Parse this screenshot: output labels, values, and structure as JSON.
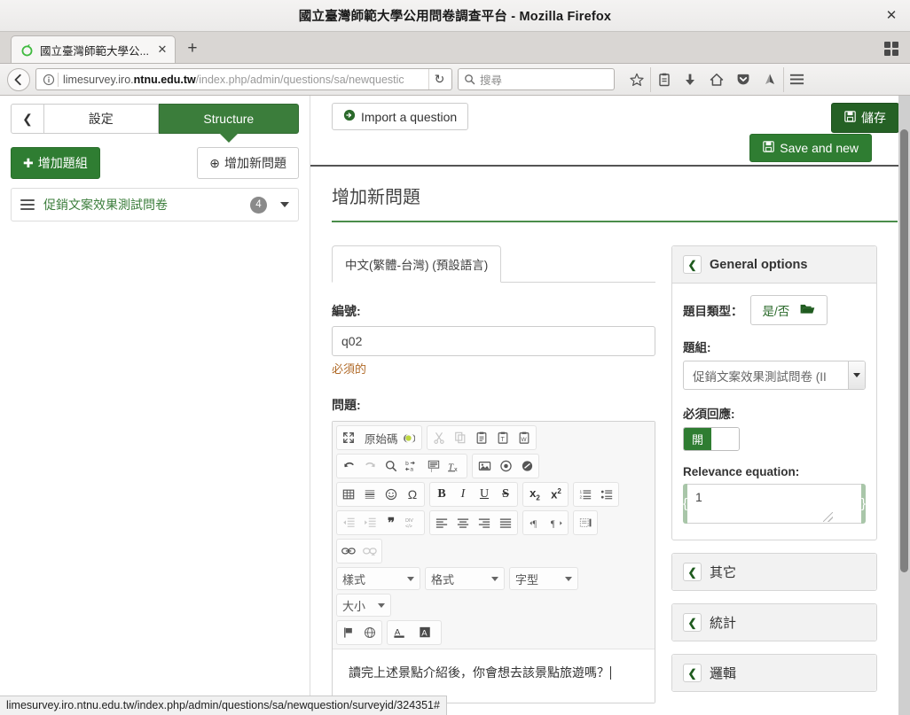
{
  "browser": {
    "window_title": "國立臺灣師範大學公用問卷調查平台 - Mozilla Firefox",
    "close_label": "✕",
    "tab": {
      "title": "國立臺灣師範大學公...",
      "close_label": "✕",
      "new_tab_label": "+"
    },
    "url": {
      "prefix": "limesurvey.iro.",
      "domain": "ntnu.edu.tw",
      "path": "/index.php/admin/questions/sa/newquestic",
      "full": "limesurvey.iro.ntnu.edu.tw/index.php/admin/questions/sa/newquestic"
    },
    "search_placeholder": "搜尋",
    "statusbar_url": "limesurvey.iro.ntnu.edu.tw/index.php/admin/questions/sa/newquestion/surveyid/324351#"
  },
  "sidebar": {
    "collapse_label": "❮",
    "tabs": [
      {
        "label": "設定",
        "active": false
      },
      {
        "label": "Structure",
        "active": true
      }
    ],
    "add_group_label": "增加題組",
    "add_question_label": "增加新問題",
    "groups": [
      {
        "name": "促銷文案效果測試問卷",
        "count": "4"
      }
    ]
  },
  "toolbar": {
    "import_label": "Import a question",
    "save_label": "儲存",
    "save_and_new_label": "Save and new"
  },
  "main": {
    "page_title": "增加新問題",
    "language_tab": "中文(繁體-台灣) (預設語言)",
    "code_label": "編號:",
    "code_value": "q02",
    "code_help": "必須的",
    "question_label": "問題:",
    "question_text": "讀完上述景點介紹後，你會想去該景點旅遊嗎？"
  },
  "editor": {
    "row1_group1": [
      {
        "icon": "maximize-icon",
        "glyph": "⤢"
      },
      {
        "icon": "source-icon",
        "glyph": "原始碼",
        "text": true
      },
      {
        "icon": "limesurvey-leaf-icon",
        "glyph": "❨❩"
      }
    ],
    "row1_group2": [
      {
        "icon": "cut-icon",
        "glyph": "✂",
        "disabled": true
      },
      {
        "icon": "copy-icon",
        "glyph": "❐",
        "disabled": true
      },
      {
        "icon": "paste-icon",
        "glyph": "📋"
      },
      {
        "icon": "paste-text-icon",
        "glyph": "T"
      },
      {
        "icon": "paste-word-icon",
        "glyph": "W"
      }
    ],
    "row2_group1": [
      {
        "icon": "undo-icon",
        "glyph": "↰"
      },
      {
        "icon": "redo-icon",
        "glyph": "↱",
        "disabled": true
      },
      {
        "icon": "find-icon",
        "glyph": "🔍"
      },
      {
        "icon": "replace-icon",
        "glyph": "ab"
      },
      {
        "icon": "select-all-icon",
        "glyph": "☰"
      },
      {
        "icon": "remove-format-icon",
        "glyph": "Tx"
      }
    ],
    "row2_group2": [
      {
        "icon": "image-icon",
        "glyph": "🖼"
      },
      {
        "icon": "media-icon",
        "glyph": "⏺"
      },
      {
        "icon": "flash-icon",
        "glyph": "◍"
      }
    ],
    "row3_group1": [
      {
        "icon": "table-icon",
        "glyph": "▦"
      },
      {
        "icon": "horizontal-rule-icon",
        "glyph": "▤"
      },
      {
        "icon": "smiley-icon",
        "glyph": "☺"
      },
      {
        "icon": "special-char-icon",
        "glyph": "Ω"
      }
    ],
    "row3_group2": [
      {
        "icon": "bold-icon",
        "glyph": "B"
      },
      {
        "icon": "italic-icon",
        "glyph": "I"
      },
      {
        "icon": "underline-icon",
        "glyph": "U"
      },
      {
        "icon": "strikethrough-icon",
        "glyph": "S"
      }
    ],
    "row3_group3": [
      {
        "icon": "subscript-icon",
        "glyph": "x₂"
      },
      {
        "icon": "superscript-icon",
        "glyph": "x²"
      }
    ],
    "row3_group4": [
      {
        "icon": "numbered-list-icon",
        "glyph": "⒈≡"
      },
      {
        "icon": "bulleted-list-icon",
        "glyph": "•≡"
      }
    ],
    "row4_group1": [
      {
        "icon": "outdent-icon",
        "glyph": "⇤",
        "disabled": true
      },
      {
        "icon": "indent-icon",
        "glyph": "⇥",
        "disabled": true
      },
      {
        "icon": "blockquote-icon",
        "glyph": "❞"
      },
      {
        "icon": "div-container-icon",
        "glyph": "DIV"
      }
    ],
    "row4_group2": [
      {
        "icon": "align-left-icon",
        "glyph": "≡"
      },
      {
        "icon": "align-center-icon",
        "glyph": "≡"
      },
      {
        "icon": "align-right-icon",
        "glyph": "≡"
      },
      {
        "icon": "justify-icon",
        "glyph": "≡"
      }
    ],
    "row4_group3": [
      {
        "icon": "ltr-icon",
        "glyph": "¶"
      },
      {
        "icon": "rtl-icon",
        "glyph": "¶"
      }
    ],
    "row4_group4": [
      {
        "icon": "show-blocks-icon",
        "glyph": "▢"
      }
    ],
    "row5_group1": [
      {
        "icon": "link-icon",
        "glyph": "🔗"
      },
      {
        "icon": "unlink-icon",
        "glyph": "⛓",
        "disabled": true
      }
    ],
    "combos": [
      {
        "label": "樣式",
        "name": "styles-combo"
      },
      {
        "label": "格式",
        "name": "format-combo"
      },
      {
        "label": "字型",
        "name": "font-combo"
      },
      {
        "label": "大小",
        "name": "fontsize-combo"
      }
    ],
    "row7_group1": [
      {
        "icon": "bookmark-flag-icon",
        "glyph": "⚑"
      },
      {
        "icon": "language-globe-icon",
        "glyph": "🌐"
      }
    ],
    "row7_group2": [
      {
        "icon": "text-color-icon",
        "glyph": "A"
      },
      {
        "icon": "background-color-icon",
        "glyph": "A"
      }
    ]
  },
  "options": {
    "general": {
      "title": "General options",
      "chevron": "❮",
      "question_type_label": "題目類型：",
      "question_type_value": "是/否",
      "question_group_label": "題組:",
      "question_group_value": "促銷文案效果測試問卷 (II",
      "mandatory_label": "必須回應:",
      "mandatory_on": "開",
      "relevance_label": "Relevance equation:",
      "relevance_brace_left": "{",
      "relevance_brace_right": "}",
      "relevance_value": "1"
    },
    "collapsed_panels": [
      {
        "title": "其它",
        "chevron": "❮",
        "name": "panel-other"
      },
      {
        "title": "統計",
        "chevron": "❮",
        "name": "panel-statistics"
      },
      {
        "title": "邏輯",
        "chevron": "❮",
        "name": "panel-logic"
      }
    ]
  }
}
